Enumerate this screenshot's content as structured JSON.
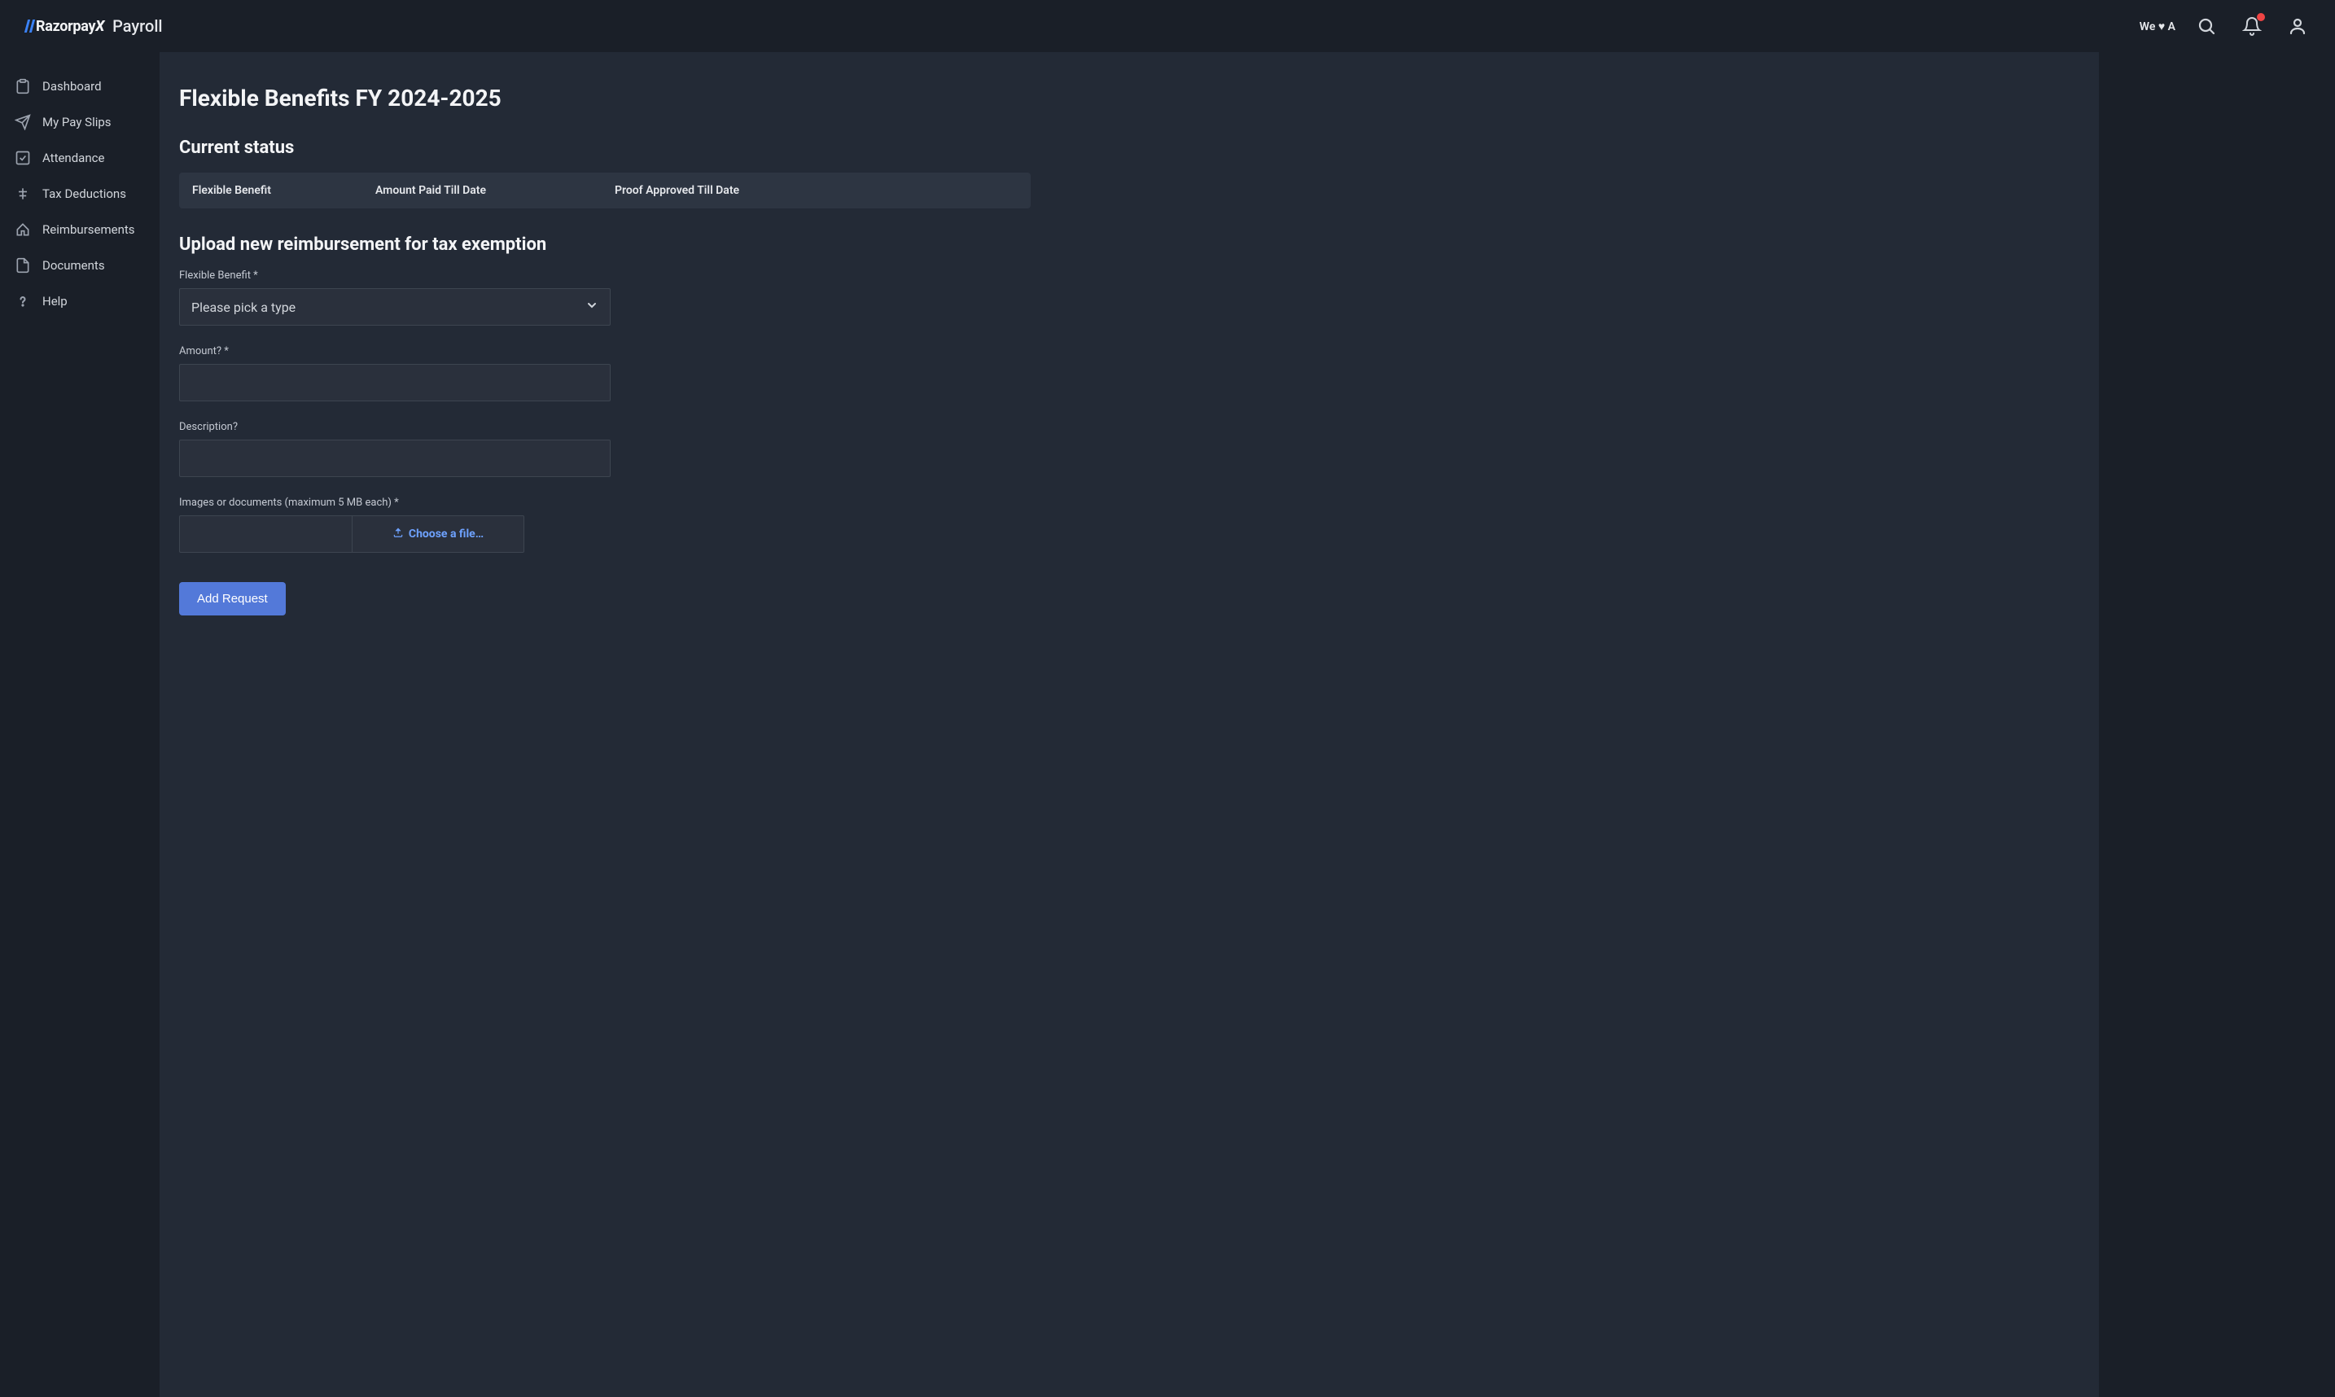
{
  "header": {
    "brand_text": "Razorpay",
    "brand_accent": "X",
    "product": "Payroll",
    "heart_text": "We ♥ A"
  },
  "sidebar": {
    "items": [
      {
        "label": "Dashboard"
      },
      {
        "label": "My Pay Slips"
      },
      {
        "label": "Attendance"
      },
      {
        "label": "Tax Deductions"
      },
      {
        "label": "Reimbursements"
      },
      {
        "label": "Documents"
      },
      {
        "label": "Help"
      }
    ]
  },
  "main": {
    "page_title": "Flexible Benefits FY 2024-2025",
    "current_status_title": "Current status",
    "table_headers": {
      "flexible_benefit": "Flexible Benefit",
      "amount_paid": "Amount Paid Till Date",
      "proof_approved": "Proof Approved Till Date"
    },
    "upload_title": "Upload new reimbursement for tax exemption",
    "form": {
      "benefit_label": "Flexible Benefit *",
      "benefit_placeholder": "Please pick a type",
      "amount_label": "Amount? *",
      "description_label": "Description?",
      "files_label": "Images or documents (maximum 5 MB each) *",
      "choose_file_label": "Choose a file…",
      "submit_label": "Add Request"
    }
  }
}
